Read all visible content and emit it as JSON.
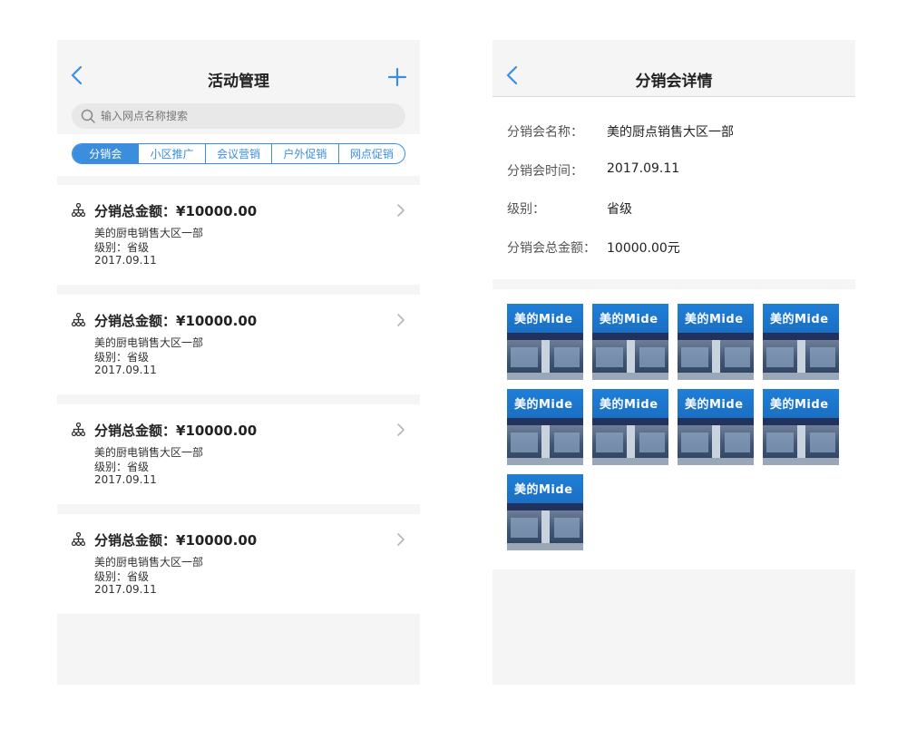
{
  "left": {
    "nav": {
      "title": "活动管理"
    },
    "search": {
      "placeholder": "输入网点名称搜索"
    },
    "tabs": [
      {
        "label": "分销会",
        "active": true
      },
      {
        "label": "小区推广",
        "active": false
      },
      {
        "label": "会议营销",
        "active": false
      },
      {
        "label": "户外促销",
        "active": false
      },
      {
        "label": "网点促销",
        "active": false
      }
    ],
    "items": [
      {
        "amount": "分销总金额：¥10000.00",
        "name": "美的厨电销售大区一部",
        "level": "级别：省级",
        "date": "2017.09.11"
      },
      {
        "amount": "分销总金额：¥10000.00",
        "name": "美的厨电销售大区一部",
        "level": "级别：省级",
        "date": "2017.09.11"
      },
      {
        "amount": "分销总金额：¥10000.00",
        "name": "美的厨电销售大区一部",
        "level": "级别：省级",
        "date": "2017.09.11"
      },
      {
        "amount": "分销总金额：¥10000.00",
        "name": "美的厨电销售大区一部",
        "level": "级别：省级",
        "date": "2017.09.11"
      }
    ]
  },
  "right": {
    "nav": {
      "title": "分销会详情"
    },
    "fields": [
      {
        "key": "分销会名称：",
        "value": "美的厨点销售大区一部"
      },
      {
        "key": "分销会时间：",
        "value": "2017.09.11"
      },
      {
        "key": "级别：",
        "value": "省级"
      },
      {
        "key": "分销会总金额：",
        "value": "10000.00元"
      }
    ],
    "photo_brand": "美的Mide",
    "photo_count": 9
  },
  "colors": {
    "accent": "#3b8ede",
    "background": "#f5f5f5"
  },
  "icons": [
    "chevron-left-icon",
    "plus-icon",
    "search-icon",
    "org-chart-icon",
    "chevron-right-icon"
  ]
}
